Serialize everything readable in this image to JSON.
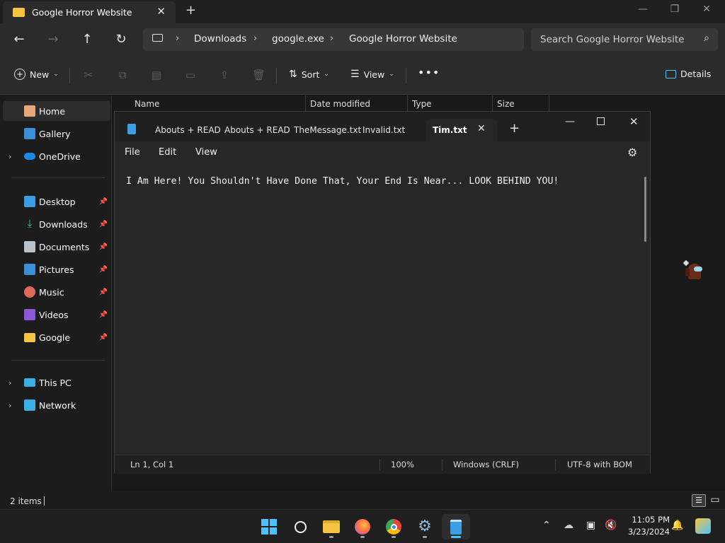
{
  "explorer": {
    "tab_title": "Google Horror Website",
    "breadcrumbs": [
      "Downloads",
      "google.exe",
      "Google Horror Website"
    ],
    "search_placeholder": "Search Google Horror Website",
    "commands": {
      "new": "New",
      "sort": "Sort",
      "view": "View",
      "details": "Details"
    },
    "columns": [
      "Name",
      "Date modified",
      "Type",
      "Size"
    ],
    "sidebar": [
      {
        "label": "Home",
        "icon": "home-icon"
      },
      {
        "label": "Gallery",
        "icon": "gallery-icon"
      },
      {
        "label": "OneDrive",
        "icon": "onedrive-icon"
      },
      {
        "label": "Desktop",
        "icon": "desktop-icon"
      },
      {
        "label": "Downloads",
        "icon": "downloads-icon"
      },
      {
        "label": "Documents",
        "icon": "documents-icon"
      },
      {
        "label": "Pictures",
        "icon": "pictures-icon"
      },
      {
        "label": "Music",
        "icon": "music-icon"
      },
      {
        "label": "Videos",
        "icon": "videos-icon"
      },
      {
        "label": "Google",
        "icon": "folder-icon"
      },
      {
        "label": "This PC",
        "icon": "this-pc-icon"
      },
      {
        "label": "Network",
        "icon": "network-icon"
      }
    ],
    "status_items": "2 items"
  },
  "notepad": {
    "tabs": [
      "Abouts + READ",
      "Abouts + READ",
      "TheMessage.txt",
      "Invalid.txt",
      "Tim.txt"
    ],
    "menu": [
      "File",
      "Edit",
      "View"
    ],
    "content": "I Am Here! You Shouldn't Have Done That, Your End Is Near... LOOK BEHIND YOU!",
    "status": {
      "position": "Ln 1, Col 1",
      "zoom": "100%",
      "line_ending": "Windows (CRLF)",
      "encoding": "UTF-8 with BOM"
    }
  },
  "taskbar": {
    "time": "11:05 PM",
    "date": "3/23/2024",
    "apps": [
      "windows-start-icon",
      "search-icon",
      "file-explorer-icon",
      "firefox-icon",
      "chrome-icon",
      "settings-icon",
      "notepad-icon"
    ]
  },
  "colors": {
    "accent": "#4cc2ff",
    "folder": "#f5c443",
    "window_bg": "#272727"
  }
}
